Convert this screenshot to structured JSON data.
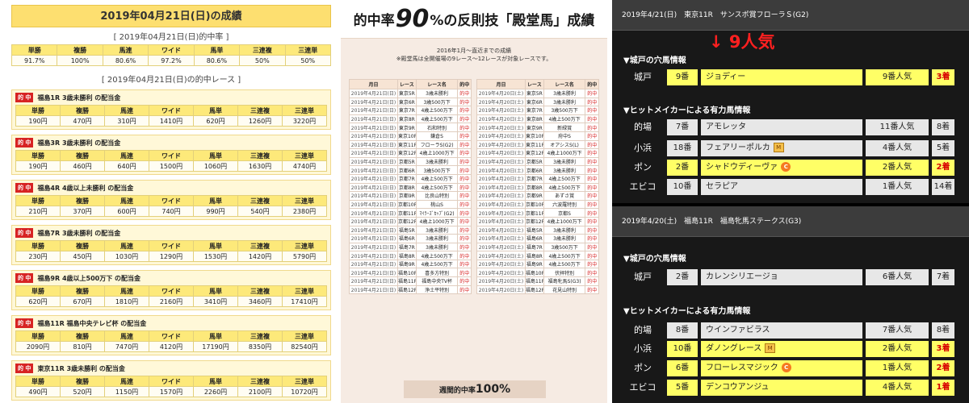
{
  "left": {
    "title": "2019年04月21日(日)の成績",
    "rate_caption": "[ 2019年04月21日(日)的中率 ]",
    "rate_headers": [
      "単勝",
      "複勝",
      "馬連",
      "ワイド",
      "馬単",
      "三連複",
      "三連単"
    ],
    "rate_values": [
      "91.7%",
      "100%",
      "80.6%",
      "97.2%",
      "80.6%",
      "50%",
      "50%"
    ],
    "races_caption": "[ 2019年04月21日(日)の的中レース ]",
    "badge": "的 中",
    "bet_headers": [
      "単勝",
      "複勝",
      "馬連",
      "ワイド",
      "馬単",
      "三連複",
      "三連単"
    ],
    "races": [
      {
        "title": "福島1R 3歳未勝利 の配当金",
        "payouts": [
          "190円",
          "470円",
          "310円",
          "1410円",
          "620円",
          "1260円",
          "3220円"
        ]
      },
      {
        "title": "福島3R 3歳未勝利 の配当金",
        "payouts": [
          "190円",
          "460円",
          "640円",
          "1500円",
          "1060円",
          "1630円",
          "4740円"
        ]
      },
      {
        "title": "福島4R 4歳以上未勝利 の配当金",
        "payouts": [
          "210円",
          "370円",
          "600円",
          "740円",
          "990円",
          "540円",
          "2380円"
        ]
      },
      {
        "title": "福島7R 3歳未勝利 の配当金",
        "payouts": [
          "230円",
          "450円",
          "1030円",
          "1290円",
          "1530円",
          "1420円",
          "5790円"
        ]
      },
      {
        "title": "福島9R 4歳以上500万下 の配当金",
        "payouts": [
          "620円",
          "670円",
          "1810円",
          "2160円",
          "3410円",
          "3460円",
          "17410円"
        ]
      },
      {
        "title": "福島11R 福島中央テレビ杯 の配当金",
        "payouts": [
          "2090円",
          "810円",
          "7470円",
          "4120円",
          "17190円",
          "8350円",
          "82540円"
        ]
      },
      {
        "title": "東京11R 3歳未勝利 の配当金",
        "payouts": [
          "490円",
          "520円",
          "1150円",
          "1570円",
          "2260円",
          "2100円",
          "10720円"
        ]
      }
    ]
  },
  "mid": {
    "head_pre": "的中率",
    "head_big": "90",
    "head_post": "%の反則技「殿堂馬」成績",
    "note1": "2016年1月～直近までの成績",
    "note2": "※殿堂馬は全開催場の9レース～12レースが対象レースです。",
    "headers": [
      "月日",
      "レース",
      "レース名",
      "的中"
    ],
    "left_rows": [
      [
        "2019年4月21日(日)",
        "東京5R",
        "3歳未勝利",
        "的中"
      ],
      [
        "2019年4月21日(日)",
        "東京6R",
        "3歳500万下",
        "的中"
      ],
      [
        "2019年4月21日(日)",
        "東京7R",
        "4歳上500万下",
        "的中"
      ],
      [
        "2019年4月21日(日)",
        "東京8R",
        "4歳上500万下",
        "的中"
      ],
      [
        "2019年4月21日(日)",
        "東京9R",
        "石和特別",
        "的中"
      ],
      [
        "2019年4月21日(日)",
        "東京10R",
        "鎌倉S",
        "的中"
      ],
      [
        "2019年4月21日(日)",
        "東京11R",
        "フローラS(G2)",
        "的中"
      ],
      [
        "2019年4月21日(日)",
        "東京12R",
        "4歳上1000万下",
        "的中"
      ],
      [
        "2019年4月21日(日)",
        "京都5R",
        "3歳未勝利",
        "的中"
      ],
      [
        "2019年4月21日(日)",
        "京都6R",
        "3歳500万下",
        "的中"
      ],
      [
        "2019年4月21日(日)",
        "京都7R",
        "4歳上500万下",
        "的中"
      ],
      [
        "2019年4月21日(日)",
        "京都8R",
        "4歳上500万下",
        "的中"
      ],
      [
        "2019年4月21日(日)",
        "京都9R",
        "比良山特別",
        "的中"
      ],
      [
        "2019年4月21日(日)",
        "京都10R",
        "桃山S",
        "的中"
      ],
      [
        "2019年4月21日(日)",
        "京都11R",
        "ﾏｲﾗｰｽﾞｶｯﾌﾟ(G2)",
        "的中"
      ],
      [
        "2019年4月21日(日)",
        "京都12R",
        "4歳上1000万下",
        "的中"
      ],
      [
        "2019年4月21日(日)",
        "福島5R",
        "3歳未勝利",
        "的中"
      ],
      [
        "2019年4月21日(日)",
        "福島6R",
        "3歳未勝利",
        "的中"
      ],
      [
        "2019年4月21日(日)",
        "福島7R",
        "3歳未勝利",
        "的中"
      ],
      [
        "2019年4月21日(日)",
        "福島8R",
        "4歳上500万下",
        "的中"
      ],
      [
        "2019年4月21日(日)",
        "福島9R",
        "4歳上500万下",
        "的中"
      ],
      [
        "2019年4月21日(日)",
        "福島10R",
        "喜多方特別",
        "的中"
      ],
      [
        "2019年4月21日(日)",
        "福島11R",
        "福島中央TV杯",
        "的中"
      ],
      [
        "2019年4月21日(日)",
        "福島12R",
        "浄土平特別",
        "的中"
      ]
    ],
    "right_rows": [
      [
        "2019年4月20日(土)",
        "東京5R",
        "3歳未勝利",
        "的中"
      ],
      [
        "2019年4月20日(土)",
        "東京6R",
        "3歳未勝利",
        "的中"
      ],
      [
        "2019年4月20日(土)",
        "東京7R",
        "3歳500万下",
        "的中"
      ],
      [
        "2019年4月20日(土)",
        "東京8R",
        "4歳上500万下",
        "的中"
      ],
      [
        "2019年4月20日(土)",
        "東京9R",
        "新緑賞",
        "的中"
      ],
      [
        "2019年4月20日(土)",
        "東京10R",
        "府中S",
        "的中"
      ],
      [
        "2019年4月20日(土)",
        "東京11R",
        "オアシスS(L)",
        "的中"
      ],
      [
        "2019年4月20日(土)",
        "東京12R",
        "4歳上1000万下",
        "的中"
      ],
      [
        "2019年4月20日(土)",
        "京都5R",
        "3歳未勝利",
        "的中"
      ],
      [
        "2019年4月20日(土)",
        "京都6R",
        "3歳未勝利",
        "的中"
      ],
      [
        "2019年4月20日(土)",
        "京都7R",
        "4歳上500万下",
        "的中"
      ],
      [
        "2019年4月20日(土)",
        "京都8R",
        "4歳上500万下",
        "的中"
      ],
      [
        "2019年4月20日(土)",
        "京都9R",
        "あずさ賞",
        "的中"
      ],
      [
        "2019年4月20日(土)",
        "京都10R",
        "六波羅特別",
        "的中"
      ],
      [
        "2019年4月20日(土)",
        "京都11R",
        "京都S",
        "的中"
      ],
      [
        "2019年4月20日(土)",
        "京都12R",
        "4歳上1000万下",
        "的中"
      ],
      [
        "2019年4月20日(土)",
        "福島5R",
        "3歳未勝利",
        "的中"
      ],
      [
        "2019年4月20日(土)",
        "福島6R",
        "3歳未勝利",
        "的中"
      ],
      [
        "2019年4月20日(土)",
        "福島7R",
        "3歳500万下",
        "的中"
      ],
      [
        "2019年4月20日(土)",
        "福島8R",
        "4歳上500万下",
        "的中"
      ],
      [
        "2019年4月20日(土)",
        "福島9R",
        "4歳上500万下",
        "的中"
      ],
      [
        "2019年4月20日(土)",
        "福島10R",
        "伏拝特別",
        "的中"
      ],
      [
        "2019年4月20日(土)",
        "福島11R",
        "福島牝馬S(G3)",
        "的中"
      ],
      [
        "2019年4月20日(土)",
        "福島12R",
        "花見山特別",
        "的中"
      ]
    ],
    "footer_pre": "週間的中率",
    "footer_big": "100%"
  },
  "right": {
    "ninki_label": "↓ 9人気",
    "block1": {
      "title": "2019年4/21(日)　東京11R　サンスポ賞フローラＳ(G2)",
      "sec1": "▼城戸の穴馬情報",
      "sec2": "▼ヒットメイカーによる有力馬情報",
      "ana": {
        "lbl": "城戸",
        "num": "9番",
        "name": "ジョディー",
        "pop": "9番人気",
        "fin": "3着",
        "hl": true,
        "icon": ""
      },
      "rows": [
        {
          "lbl": "的場",
          "num": "7番",
          "name": "アモレッタ",
          "pop": "11番人気",
          "fin": "8着",
          "hl": false,
          "icon": ""
        },
        {
          "lbl": "小浜",
          "num": "18番",
          "name": "フェアリーポルカ",
          "pop": "4番人気",
          "fin": "5着",
          "hl": false,
          "icon": "m"
        },
        {
          "lbl": "ポン",
          "num": "2番",
          "name": "シャドウディーヴァ",
          "pop": "2番人気",
          "fin": "2着",
          "hl": true,
          "icon": "c"
        },
        {
          "lbl": "エビコ",
          "num": "10番",
          "name": "セラピア",
          "pop": "1番人気",
          "fin": "14着",
          "hl": false,
          "icon": ""
        }
      ]
    },
    "block2": {
      "title": "2019年4/20(土)　福島11R　福島牝馬ステークス(G3)",
      "sec1": "▼城戸の穴馬情報",
      "sec2": "▼ヒットメイカーによる有力馬情報",
      "ana": {
        "lbl": "城戸",
        "num": "2番",
        "name": "カレンシリエージョ",
        "pop": "6番人気",
        "fin": "7着",
        "hl": false,
        "icon": ""
      },
      "rows": [
        {
          "lbl": "的場",
          "num": "8番",
          "name": "ウインファビラス",
          "pop": "7番人気",
          "fin": "8着",
          "hl": false,
          "icon": ""
        },
        {
          "lbl": "小浜",
          "num": "10番",
          "name": "ダノングレース",
          "pop": "2番人気",
          "fin": "3着",
          "hl": true,
          "icon": "m"
        },
        {
          "lbl": "ポン",
          "num": "6番",
          "name": "フローレスマジック",
          "pop": "1番人気",
          "fin": "2着",
          "hl": true,
          "icon": "c"
        },
        {
          "lbl": "エビコ",
          "num": "5番",
          "name": "デンコウアンジュ",
          "pop": "4番人気",
          "fin": "1着",
          "hl": true,
          "icon": ""
        }
      ]
    },
    "icons": {
      "m": "M",
      "c": "C"
    }
  }
}
